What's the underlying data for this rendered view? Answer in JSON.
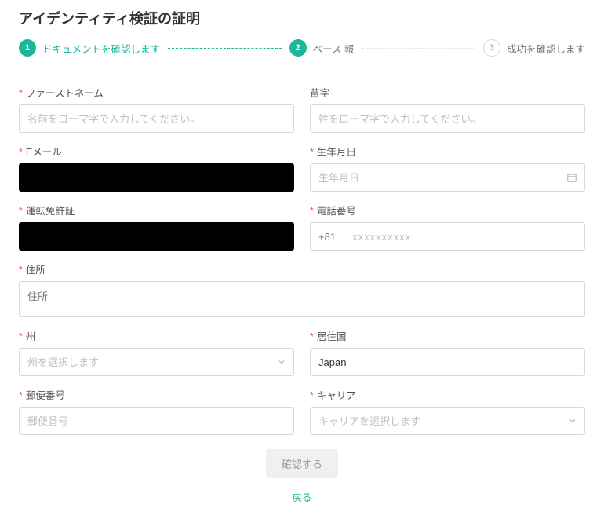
{
  "title": "アイデンティティ検証の証明",
  "steps": [
    {
      "num": "1",
      "label": "ドキュメントを確認します"
    },
    {
      "num": "2",
      "label": "ベース 報"
    },
    {
      "num": "3",
      "label": "成功を確認します"
    }
  ],
  "fields": {
    "first_name": {
      "label": "ファーストネーム",
      "placeholder": "名前をローマ字で入力してください。"
    },
    "last_name": {
      "label": "苗字",
      "placeholder": "姓をローマ字で入力してください。"
    },
    "email": {
      "label": "Eメール"
    },
    "birthdate": {
      "label": "生年月日",
      "placeholder": "生年月日"
    },
    "license": {
      "label": "運転免許証"
    },
    "phone": {
      "label": "電話番号",
      "prefix": "+81",
      "placeholder": "xxxxxxxxxx"
    },
    "address": {
      "label": "住所",
      "placeholder": "住所"
    },
    "state": {
      "label": "州",
      "placeholder": "州を選択します"
    },
    "country": {
      "label": "居住国",
      "value": "Japan"
    },
    "postcode": {
      "label": "郵便番号",
      "placeholder": "郵便番号"
    },
    "carrier": {
      "label": "キャリア",
      "placeholder": "キャリアを選択します"
    }
  },
  "actions": {
    "confirm": "確認する",
    "back": "戻る"
  }
}
